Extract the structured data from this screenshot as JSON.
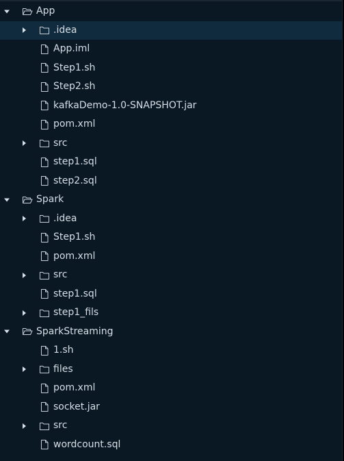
{
  "colors": {
    "panel_background": "#0a1824",
    "selected_row": "#112b3e",
    "text": "#d6dee6",
    "icon_stroke": "#c8d1da"
  },
  "tree": [
    {
      "label": "App",
      "type": "folder",
      "expanded": true,
      "children": [
        {
          "label": ".idea",
          "type": "folder",
          "expanded": false,
          "selected": true
        },
        {
          "label": "App.iml",
          "type": "file"
        },
        {
          "label": "Step1.sh",
          "type": "file"
        },
        {
          "label": "Step2.sh",
          "type": "file"
        },
        {
          "label": "kafkaDemo-1.0-SNAPSHOT.jar",
          "type": "file"
        },
        {
          "label": "pom.xml",
          "type": "file"
        },
        {
          "label": "src",
          "type": "folder",
          "expanded": false
        },
        {
          "label": "step1.sql",
          "type": "file"
        },
        {
          "label": "step2.sql",
          "type": "file"
        }
      ]
    },
    {
      "label": "Spark",
      "type": "folder",
      "expanded": true,
      "children": [
        {
          "label": ".idea",
          "type": "folder",
          "expanded": false
        },
        {
          "label": "Step1.sh",
          "type": "file"
        },
        {
          "label": "pom.xml",
          "type": "file"
        },
        {
          "label": "src",
          "type": "folder",
          "expanded": false
        },
        {
          "label": "step1.sql",
          "type": "file"
        },
        {
          "label": "step1_fils",
          "type": "folder",
          "expanded": false
        }
      ]
    },
    {
      "label": "SparkStreaming",
      "type": "folder",
      "expanded": true,
      "children": [
        {
          "label": "1.sh",
          "type": "file"
        },
        {
          "label": "files",
          "type": "folder",
          "expanded": false
        },
        {
          "label": "pom.xml",
          "type": "file"
        },
        {
          "label": "socket.jar",
          "type": "file"
        },
        {
          "label": "src",
          "type": "folder",
          "expanded": false
        },
        {
          "label": "wordcount.sql",
          "type": "file"
        }
      ]
    }
  ]
}
